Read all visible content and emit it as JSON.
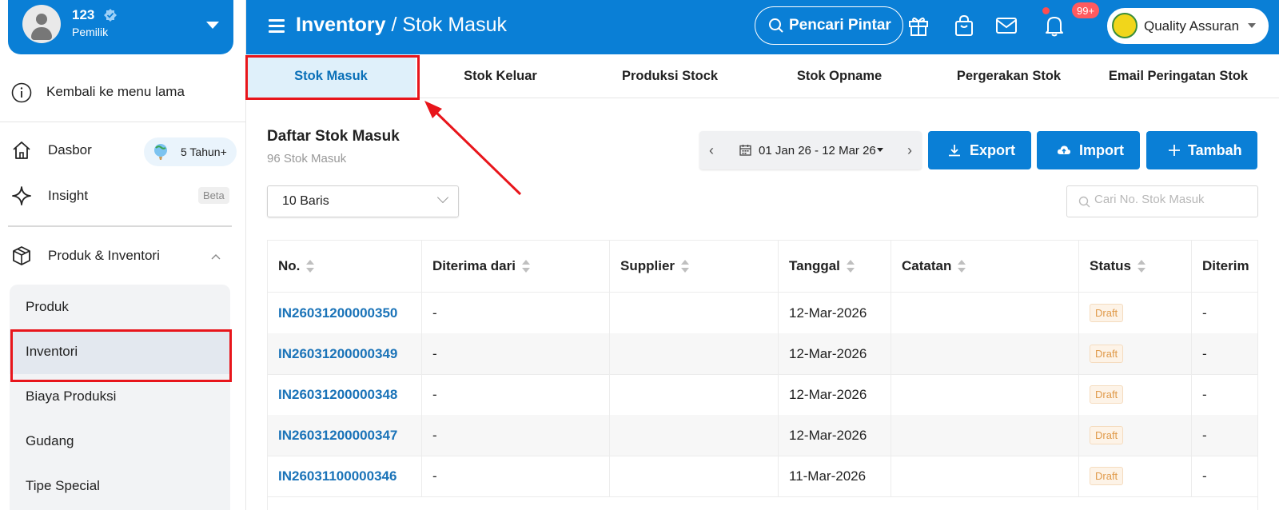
{
  "user": {
    "name": "123",
    "role": "Pemilik"
  },
  "sidebar": {
    "back_label": "Kembali ke menu lama",
    "dashboard_label": "Dasbor",
    "years_badge": "5 Tahun+",
    "insight_label": "Insight",
    "beta_label": "Beta",
    "section_label": "Produk & Inventori",
    "sub_items": [
      {
        "label": "Produk"
      },
      {
        "label": "Inventori"
      },
      {
        "label": "Biaya Produksi"
      },
      {
        "label": "Gudang"
      },
      {
        "label": "Tipe Special"
      }
    ]
  },
  "header": {
    "crumb_main": "Inventory",
    "crumb_sep": " / ",
    "crumb_sub": "Stok Masuk",
    "smart_search": "Pencari Pintar",
    "notif_count": "99+",
    "company": "Quality Assuran"
  },
  "tabs": [
    {
      "label": "Stok Masuk"
    },
    {
      "label": "Stok Keluar"
    },
    {
      "label": "Produksi Stock"
    },
    {
      "label": "Stok Opname"
    },
    {
      "label": "Pergerakan Stok"
    },
    {
      "label": "Email Peringatan Stok"
    }
  ],
  "content": {
    "title": "Daftar Stok Masuk",
    "count": "96 Stok Masuk",
    "date_range": "01 Jan 26 - 12 Mar 26",
    "export_label": "Export",
    "import_label": "Import",
    "add_label": "Tambah",
    "rows_select": "10 Baris",
    "search_placeholder": "Cari No. Stok Masuk"
  },
  "table": {
    "columns": [
      "No.",
      "Diterima dari",
      "Supplier",
      "Tanggal",
      "Catatan",
      "Status",
      "Diterim"
    ],
    "rows": [
      {
        "no": "IN26031200000350",
        "from": "-",
        "supplier": "",
        "date": "12-Mar-2026",
        "note": "",
        "status": "Draft",
        "recv": "-"
      },
      {
        "no": "IN26031200000349",
        "from": "-",
        "supplier": "",
        "date": "12-Mar-2026",
        "note": "",
        "status": "Draft",
        "recv": "-"
      },
      {
        "no": "IN26031200000348",
        "from": "-",
        "supplier": "",
        "date": "12-Mar-2026",
        "note": "",
        "status": "Draft",
        "recv": "-"
      },
      {
        "no": "IN26031200000347",
        "from": "-",
        "supplier": "",
        "date": "12-Mar-2026",
        "note": "",
        "status": "Draft",
        "recv": "-"
      },
      {
        "no": "IN26031100000346",
        "from": "-",
        "supplier": "",
        "date": "11-Mar-2026",
        "note": "",
        "status": "Draft",
        "recv": "-"
      }
    ]
  },
  "colors": {
    "brand": "#0a7fd6",
    "highlight": "#e8151b",
    "link": "#1a73b8"
  }
}
